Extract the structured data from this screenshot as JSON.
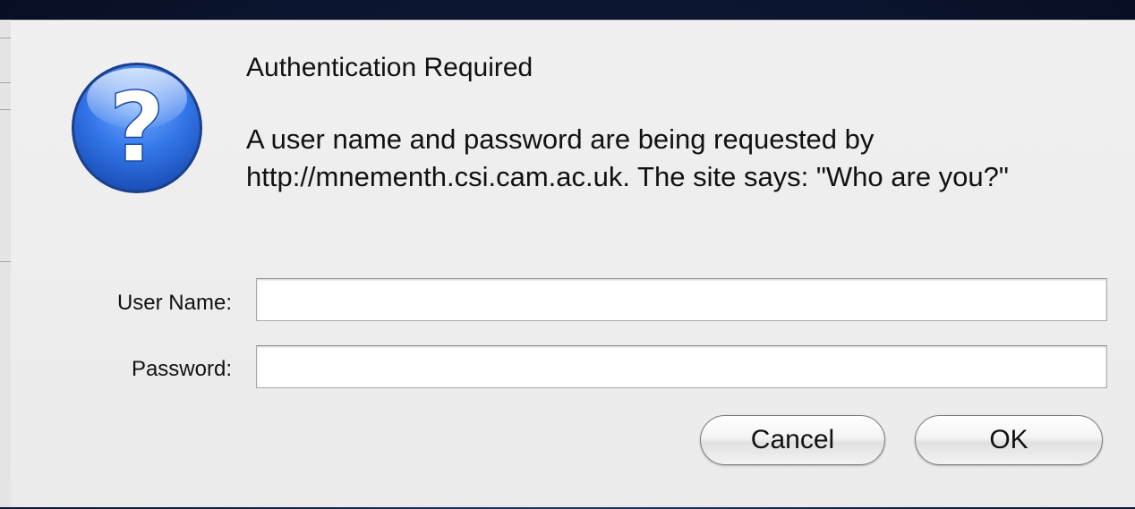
{
  "dialog": {
    "icon": "question-mark-icon",
    "title": "Authentication Required",
    "message": "A user name and password are being requested by http://mnementh.csi.cam.ac.uk. The site says: \"Who are you?\"",
    "icon_glyph": "?",
    "accent_color": "#2f6fe0"
  },
  "form": {
    "username_label": "User Name:",
    "username_value": "",
    "password_label": "Password:",
    "password_value": ""
  },
  "buttons": {
    "cancel_label": "Cancel",
    "ok_label": "OK"
  }
}
